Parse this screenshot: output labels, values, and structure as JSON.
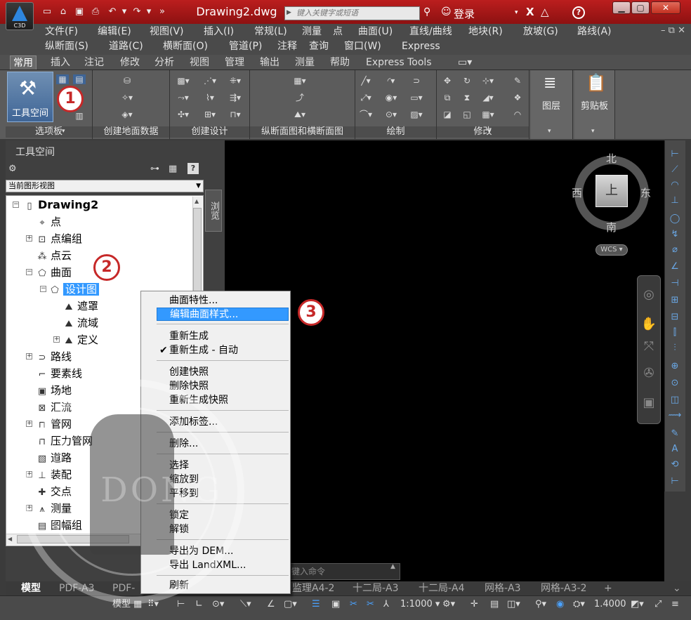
{
  "app": {
    "logo_text": "C3D"
  },
  "title_bar": {
    "document_title": "Drawing2.dwg",
    "search_placeholder": "键入关键字或短语",
    "login_label": "登录",
    "help_label": "?"
  },
  "menu_bar": {
    "row1": [
      "文件(F)",
      "编辑(E)",
      "视图(V)",
      "插入(I)",
      "常规(L)",
      "测量",
      "点",
      "曲面(U)",
      "直线/曲线",
      "地块(R)",
      "放坡(G)",
      "路线(A)"
    ],
    "row2": [
      "纵断面(S)",
      "道路(C)",
      "横断面(O)",
      "管道(P)",
      "注释",
      "查询",
      "窗口(W)",
      "Express"
    ]
  },
  "ribbon_tabs": [
    "常用",
    "插入",
    "注记",
    "修改",
    "分析",
    "视图",
    "管理",
    "输出",
    "测量",
    "帮助",
    "Express Tools"
  ],
  "ribbon_panels": {
    "tool_space_label": "工具空间",
    "titles": [
      "选项板",
      "创建地面数据",
      "创建设计",
      "纵断面图和横断面图",
      "绘制",
      "修改"
    ],
    "layers_label": "图层",
    "clipboard_label": "剪贴板"
  },
  "callouts": [
    "1",
    "2",
    "3"
  ],
  "toolspace": {
    "title": "工具空间",
    "view_select": "当前图形视图",
    "side_tab": "浏览",
    "tree": [
      {
        "label": "Drawing2",
        "icon": "drawing-icon"
      },
      {
        "label": "点",
        "icon": "point-icon"
      },
      {
        "label": "点编组",
        "icon": "point-group-icon"
      },
      {
        "label": "点云",
        "icon": "point-cloud-icon"
      },
      {
        "label": "曲面",
        "icon": "surface-icon"
      },
      {
        "label": "设计图",
        "icon": "surface-item-icon"
      },
      {
        "label": "遮罩",
        "icon": "mask-icon"
      },
      {
        "label": "流域",
        "icon": "watershed-icon"
      },
      {
        "label": "定义",
        "icon": "definition-icon"
      },
      {
        "label": "路线",
        "icon": "alignment-icon"
      },
      {
        "label": "要素线",
        "icon": "feature-line-icon"
      },
      {
        "label": "场地",
        "icon": "site-icon"
      },
      {
        "label": "汇流",
        "icon": "catchment-icon"
      },
      {
        "label": "管网",
        "icon": "pipe-network-icon"
      },
      {
        "label": "压力管网",
        "icon": "pressure-network-icon"
      },
      {
        "label": "道路",
        "icon": "corridor-icon"
      },
      {
        "label": "装配",
        "icon": "assembly-icon"
      },
      {
        "label": "交点",
        "icon": "intersection-icon"
      },
      {
        "label": "测量",
        "icon": "survey-icon"
      },
      {
        "label": "图幅组",
        "icon": "sheet-set-icon"
      }
    ]
  },
  "context_menu": {
    "items": [
      {
        "label": "曲面特性...",
        "checked": false,
        "highlighted": false
      },
      {
        "label": "编辑曲面样式...",
        "checked": false,
        "highlighted": true
      },
      {
        "label": "重新生成",
        "checked": false,
        "highlighted": false
      },
      {
        "label": "重新生成 - 自动",
        "checked": true,
        "highlighted": false
      },
      {
        "label": "创建快照",
        "checked": false,
        "highlighted": false
      },
      {
        "label": "删除快照",
        "checked": false,
        "highlighted": false
      },
      {
        "label": "重新生成快照",
        "checked": false,
        "highlighted": false
      },
      {
        "label": "添加标签...",
        "checked": false,
        "highlighted": false
      },
      {
        "label": "删除...",
        "checked": false,
        "highlighted": false
      },
      {
        "label": "选择",
        "checked": false,
        "highlighted": false
      },
      {
        "label": "缩放到",
        "checked": false,
        "highlighted": false
      },
      {
        "label": "平移到",
        "checked": false,
        "highlighted": false
      },
      {
        "label": "锁定",
        "checked": false,
        "highlighted": false
      },
      {
        "label": "解锁",
        "checked": false,
        "highlighted": false
      },
      {
        "label": "导出为 DEM...",
        "checked": false,
        "highlighted": false
      },
      {
        "label": "导出 LandXML...",
        "checked": false,
        "highlighted": false
      },
      {
        "label": "刷新",
        "checked": false,
        "highlighted": false
      }
    ]
  },
  "viewcube": {
    "north": "北",
    "south": "南",
    "east": "东",
    "west": "西",
    "face": "上",
    "wcs": "WCS"
  },
  "command_line": {
    "placeholder": "键入命令"
  },
  "layout_tabs": [
    "模型",
    "PDF-A3",
    "PDF-",
    "监理A4-2",
    "十二局-A3",
    "十二局-A4",
    "网格-A3",
    "网格-A3-2"
  ],
  "status_bar": {
    "model_label": "模型",
    "scale": "1:1000",
    "value": "1.4000"
  },
  "watermark": {
    "text": "N DONG"
  },
  "colors": {
    "title_red": "#bb1e1e",
    "highlight_blue": "#3399ff",
    "callout_red": "#c62828"
  }
}
